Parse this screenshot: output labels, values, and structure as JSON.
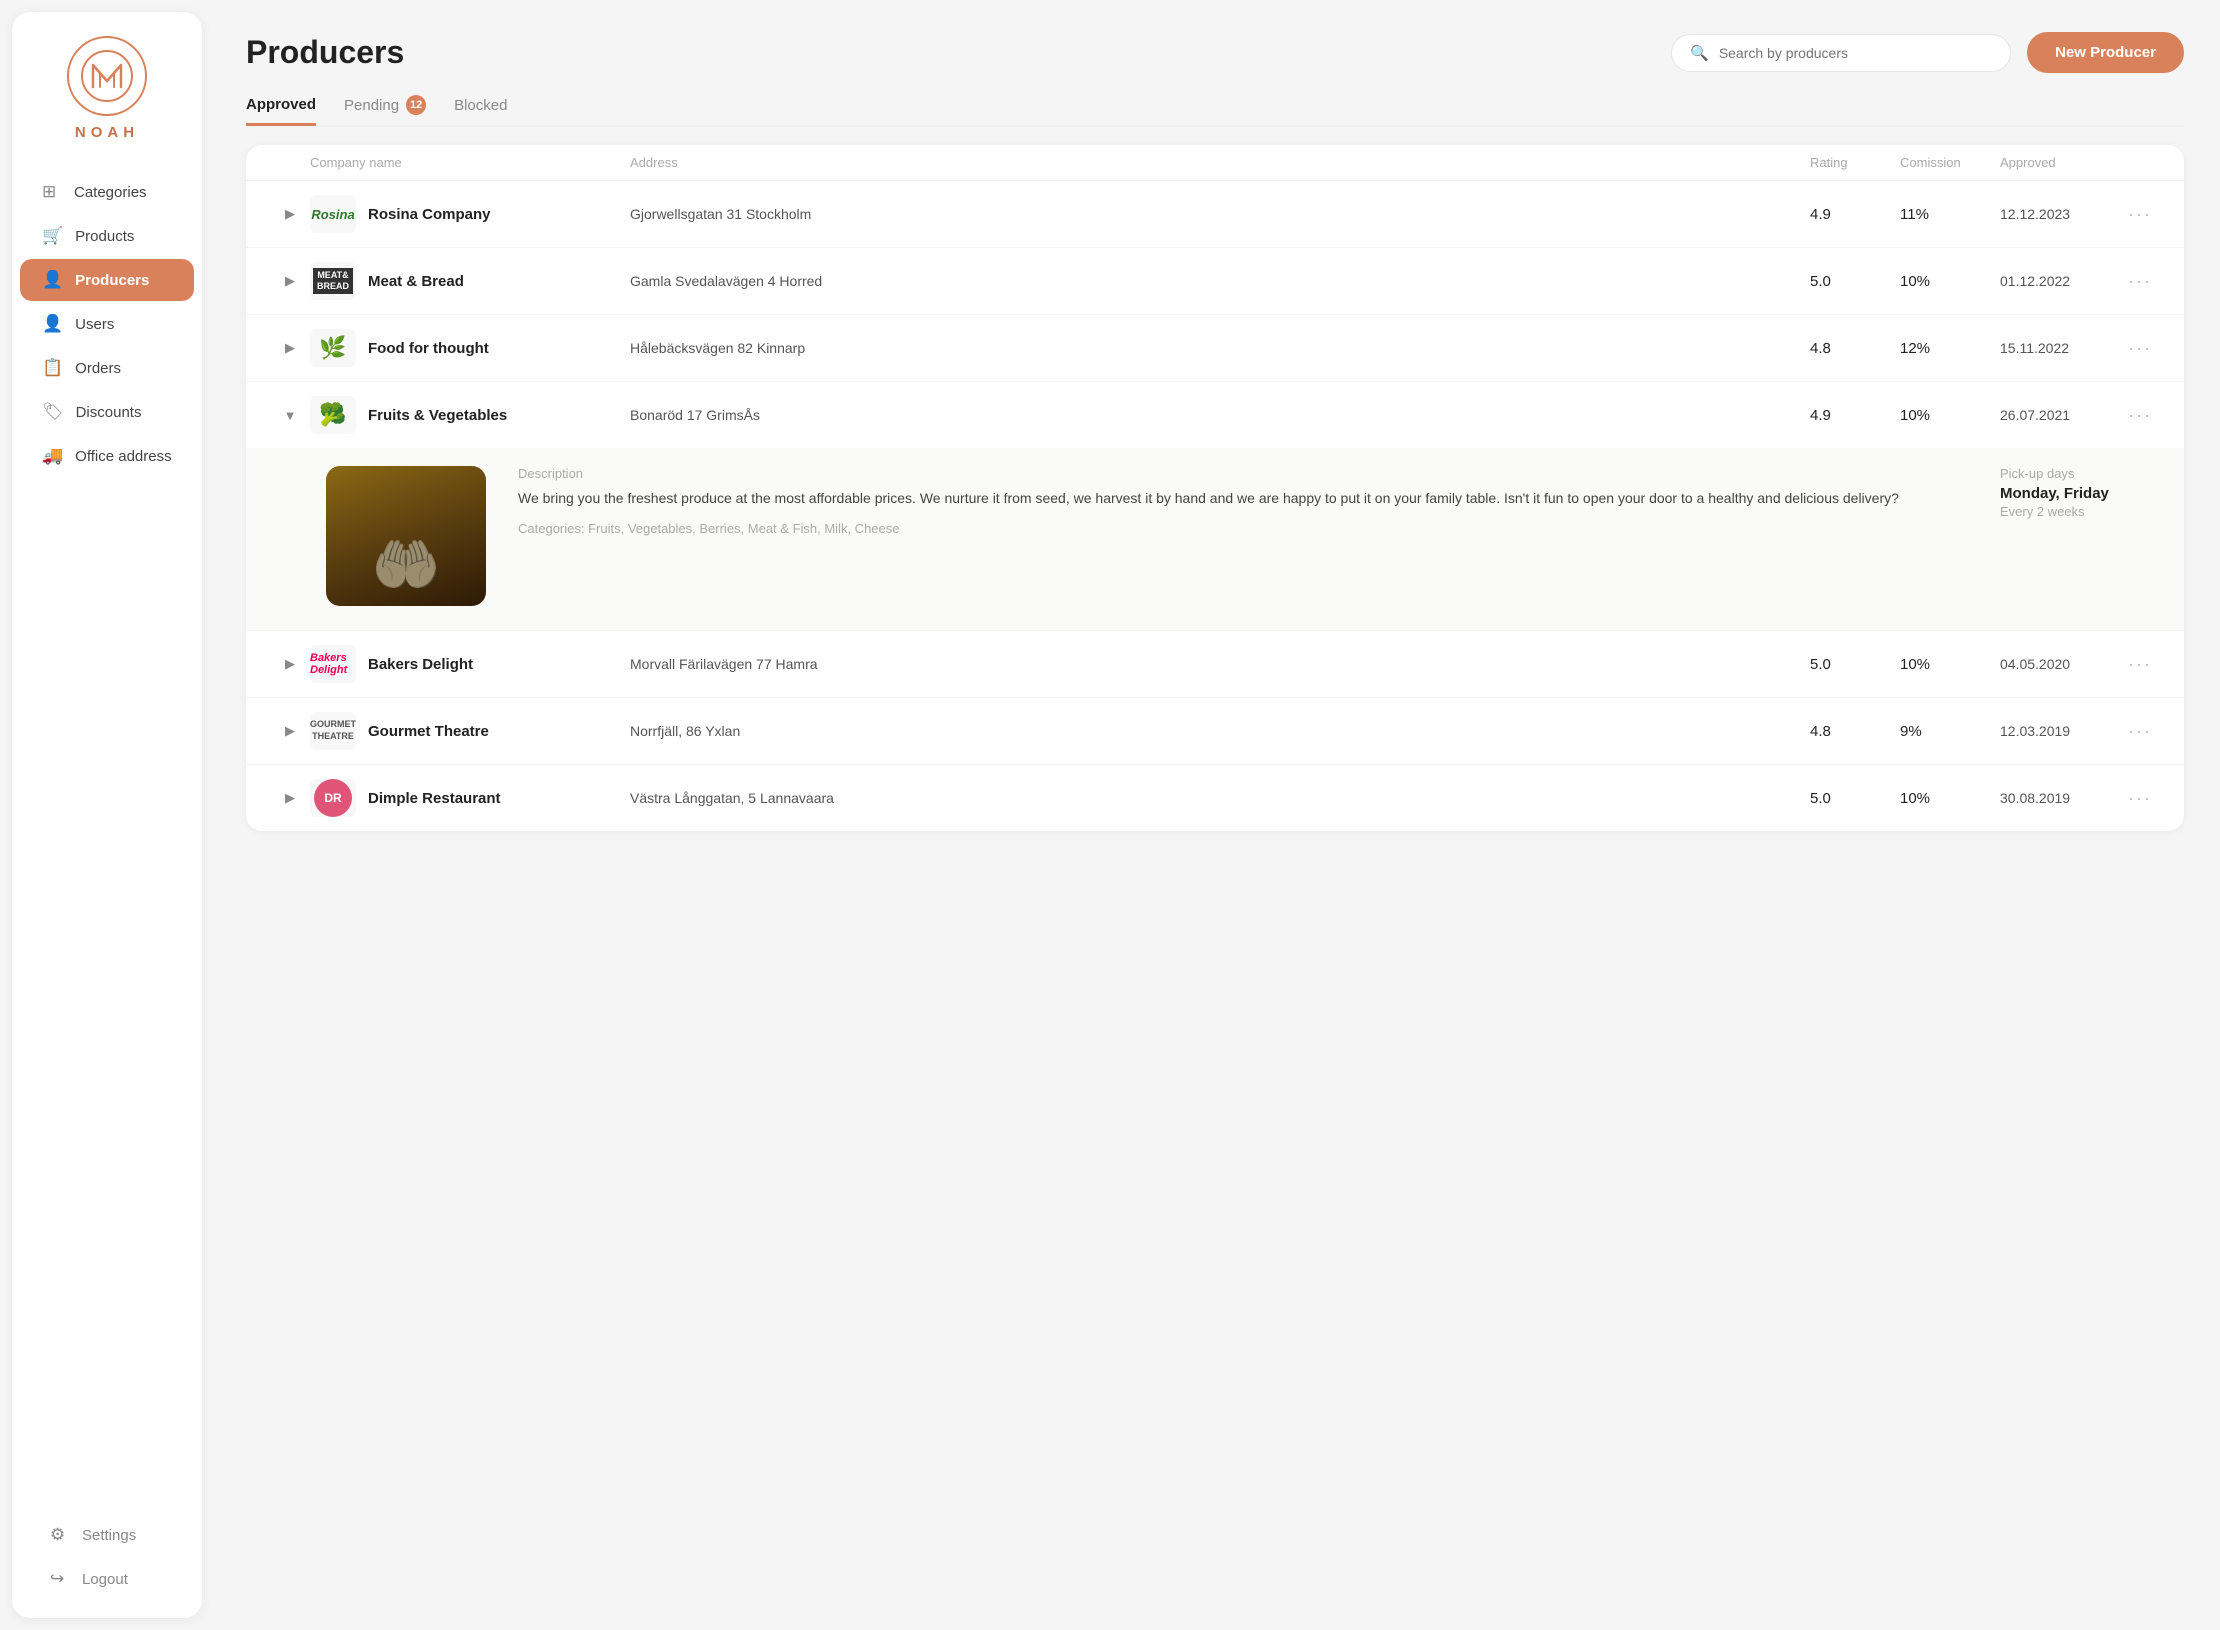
{
  "brand": {
    "name": "NOAH"
  },
  "sidebar": {
    "nav_items": [
      {
        "id": "categories",
        "label": "Categories",
        "icon": "▦"
      },
      {
        "id": "products",
        "label": "Products",
        "icon": "🛒"
      },
      {
        "id": "producers",
        "label": "Producers",
        "icon": "👤",
        "active": true
      },
      {
        "id": "users",
        "label": "Users",
        "icon": "👤"
      },
      {
        "id": "orders",
        "label": "Orders",
        "icon": "📋"
      },
      {
        "id": "discounts",
        "label": "Discounts",
        "icon": "🏷"
      },
      {
        "id": "office-address",
        "label": "Office address",
        "icon": "🚚"
      }
    ],
    "bottom_items": [
      {
        "id": "settings",
        "label": "Settings",
        "icon": "⚙"
      },
      {
        "id": "logout",
        "label": "Logout",
        "icon": "↪"
      }
    ]
  },
  "header": {
    "title": "Producers",
    "search_placeholder": "Search by producers",
    "new_producer_btn": "New Producer"
  },
  "tabs": [
    {
      "id": "approved",
      "label": "Approved",
      "active": true,
      "badge": null
    },
    {
      "id": "pending",
      "label": "Pending",
      "active": false,
      "badge": "12"
    },
    {
      "id": "blocked",
      "label": "Blocked",
      "active": false,
      "badge": null
    }
  ],
  "table": {
    "columns": [
      "",
      "Company name",
      "Address",
      "Rating",
      "Comission",
      "Approved",
      ""
    ],
    "producers": [
      {
        "id": 1,
        "logo_type": "rosina",
        "logo_text": "Rosina",
        "name": "Rosina Company",
        "address": "Gjorwellsgatan 31 Stockholm",
        "rating": "4.9",
        "commission": "11%",
        "approved": "12.12.2023",
        "expanded": false
      },
      {
        "id": 2,
        "logo_type": "meat",
        "logo_text": "MEAT & BREAD",
        "name": "Meat & Bread",
        "address": "Gamla Svedalavägen 4 Horred",
        "rating": "5.0",
        "commission": "10%",
        "approved": "01.12.2022",
        "expanded": false
      },
      {
        "id": 3,
        "logo_type": "food",
        "logo_text": "🌿",
        "name": "Food for thought",
        "address": "Hålebäcksvägen 82 Kinnarp",
        "rating": "4.8",
        "commission": "12%",
        "approved": "15.11.2022",
        "expanded": false
      },
      {
        "id": 4,
        "logo_type": "fruits",
        "logo_text": "🥦",
        "name": "Fruits & Vegetables",
        "address": "Bonaröd 17 GrimsÅs",
        "rating": "4.9",
        "commission": "10%",
        "approved": "26.07.2021",
        "expanded": true,
        "description": "We bring you the freshest produce at the most affordable prices. We nurture it from seed, we harvest it by hand and we are happy to put it on your family table. Isn't it fun to open your door to a healthy and delicious delivery?",
        "categories": "Categories: Fruits, Vegetables, Berries, Meat & Fish, Milk, Cheese",
        "pickup_days": "Monday, Friday",
        "pickup_freq": "Every 2 weeks"
      },
      {
        "id": 5,
        "logo_type": "bakers",
        "logo_text": "Bakers Delight",
        "name": "Bakers Delight",
        "address": "Morvall Färilavägen 77 Hamra",
        "rating": "5.0",
        "commission": "10%",
        "approved": "04.05.2020",
        "expanded": false
      },
      {
        "id": 6,
        "logo_type": "gourmet",
        "logo_text": "GOURMET THEATRE",
        "name": "Gourmet Theatre",
        "address": "Norrfjäll, 86 Yxlan",
        "rating": "4.8",
        "commission": "9%",
        "approved": "12.03.2019",
        "expanded": false
      },
      {
        "id": 7,
        "logo_type": "dimple",
        "logo_text": "DR",
        "name": "Dimple Restaurant",
        "address": "Västra Långgatan, 5 Lannavaara",
        "rating": "5.0",
        "commission": "10%",
        "approved": "30.08.2019",
        "expanded": false
      }
    ]
  },
  "expanded_section": {
    "description_label": "Description",
    "pickup_label": "Pick-up days"
  }
}
